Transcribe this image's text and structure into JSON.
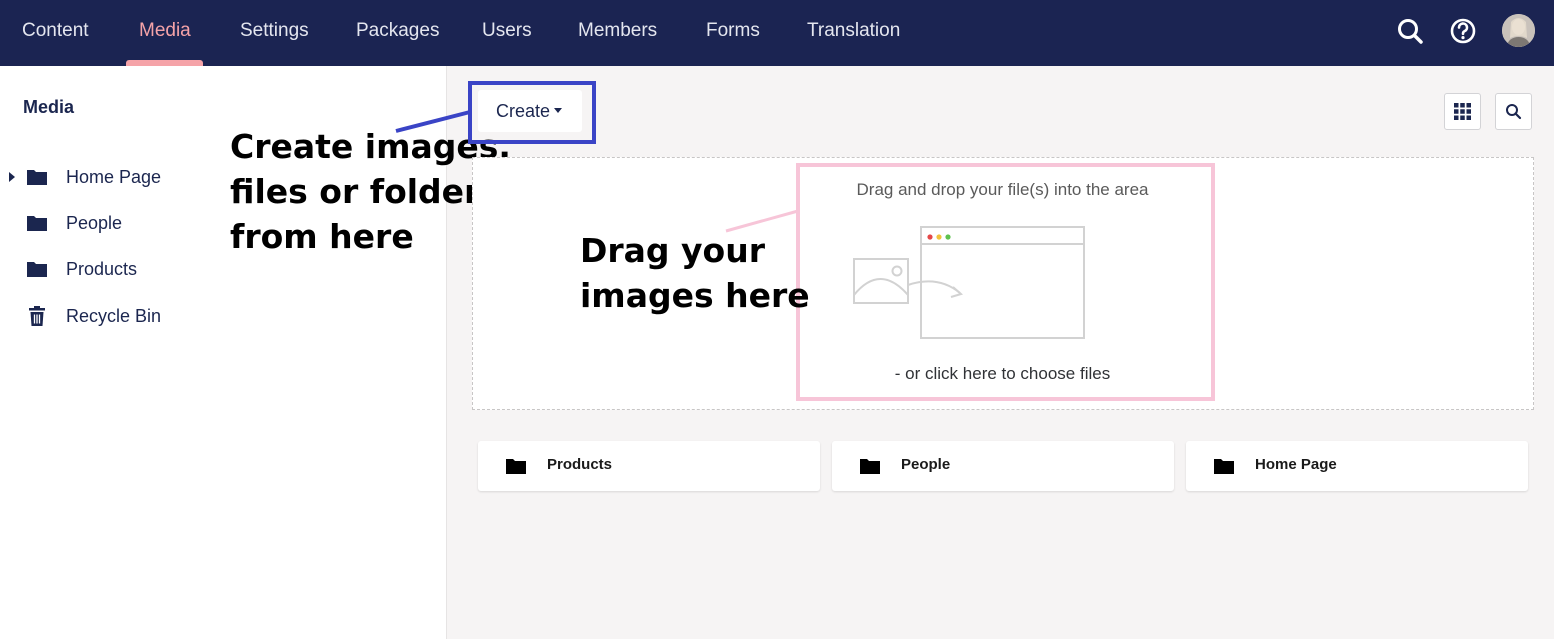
{
  "nav": {
    "items": [
      {
        "label": "Content",
        "active": false
      },
      {
        "label": "Media",
        "active": true
      },
      {
        "label": "Settings",
        "active": false
      },
      {
        "label": "Packages",
        "active": false
      },
      {
        "label": "Users",
        "active": false
      },
      {
        "label": "Members",
        "active": false
      },
      {
        "label": "Forms",
        "active": false
      },
      {
        "label": "Translation",
        "active": false
      }
    ],
    "icons": [
      "search-icon",
      "help-icon",
      "user-avatar"
    ],
    "active_color": "#f5a3a8",
    "bar_color": "#1b2452"
  },
  "sidebar": {
    "title": "Media",
    "items": [
      {
        "label": "Home Page",
        "icon": "folder-icon",
        "expandable": true
      },
      {
        "label": "People",
        "icon": "folder-icon",
        "expandable": false
      },
      {
        "label": "Products",
        "icon": "folder-icon",
        "expandable": false
      },
      {
        "label": "Recycle Bin",
        "icon": "trash-icon",
        "expandable": false
      }
    ]
  },
  "annotations": {
    "create": "Create images,\nfiles or folders\nfrom here",
    "drag": "Drag your\nimages here",
    "create_highlight_color": "#3a44c6",
    "drag_highlight_color": "#f7c5d8"
  },
  "toolbar": {
    "create_label": "Create",
    "grid_icon": "grid-icon",
    "search_icon": "search-icon"
  },
  "dropzone": {
    "title": "Drag and drop your file(s) into the area",
    "subtitle": "- or click here to choose files"
  },
  "folders": [
    {
      "label": "Products",
      "icon": "folder-icon"
    },
    {
      "label": "People",
      "icon": "folder-icon"
    },
    {
      "label": "Home Page",
      "icon": "folder-icon"
    }
  ]
}
